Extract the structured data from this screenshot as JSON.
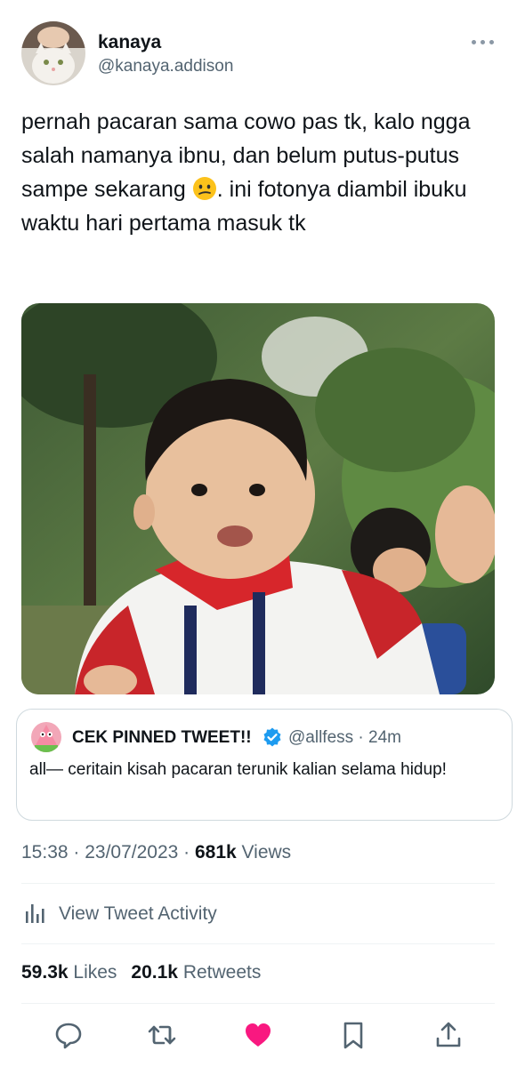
{
  "author": {
    "display_name": "kanaya",
    "handle": "@kanaya.addison"
  },
  "tweet": {
    "text_part1": "pernah pacaran sama cowo pas tk, kalo ngga salah namanya ibnu, dan belum putus-putus sampe sekarang ",
    "emoji": "confused-face-emoji",
    "text_part2": ". ini fotonya diambil ibuku waktu hari pertama masuk tk"
  },
  "quote": {
    "name": "CEK PINNED TWEET!!",
    "handle_time": "@allfess · 24m",
    "text": "all— ceritain kisah pacaran terunik kalian selama hidup!"
  },
  "meta": {
    "time_date": "15:38 · 23/07/2023 · ",
    "views_count": "681k",
    "views_label": " Views"
  },
  "activity": {
    "label": "View Tweet Activity",
    "icon": "bar-chart-icon"
  },
  "stats": {
    "likes_count": "59.3k",
    "likes_label": " Likes",
    "retweets_count": "20.1k",
    "retweets_label": " Retweets"
  },
  "colors": {
    "text": "#0f1419",
    "secondary": "#536471",
    "like_active": "#f91880",
    "verified": "#1d9bf0",
    "border": "#cfd9de"
  },
  "actions": [
    "reply-icon",
    "retweet-icon",
    "like-icon",
    "bookmark-icon",
    "share-icon"
  ]
}
